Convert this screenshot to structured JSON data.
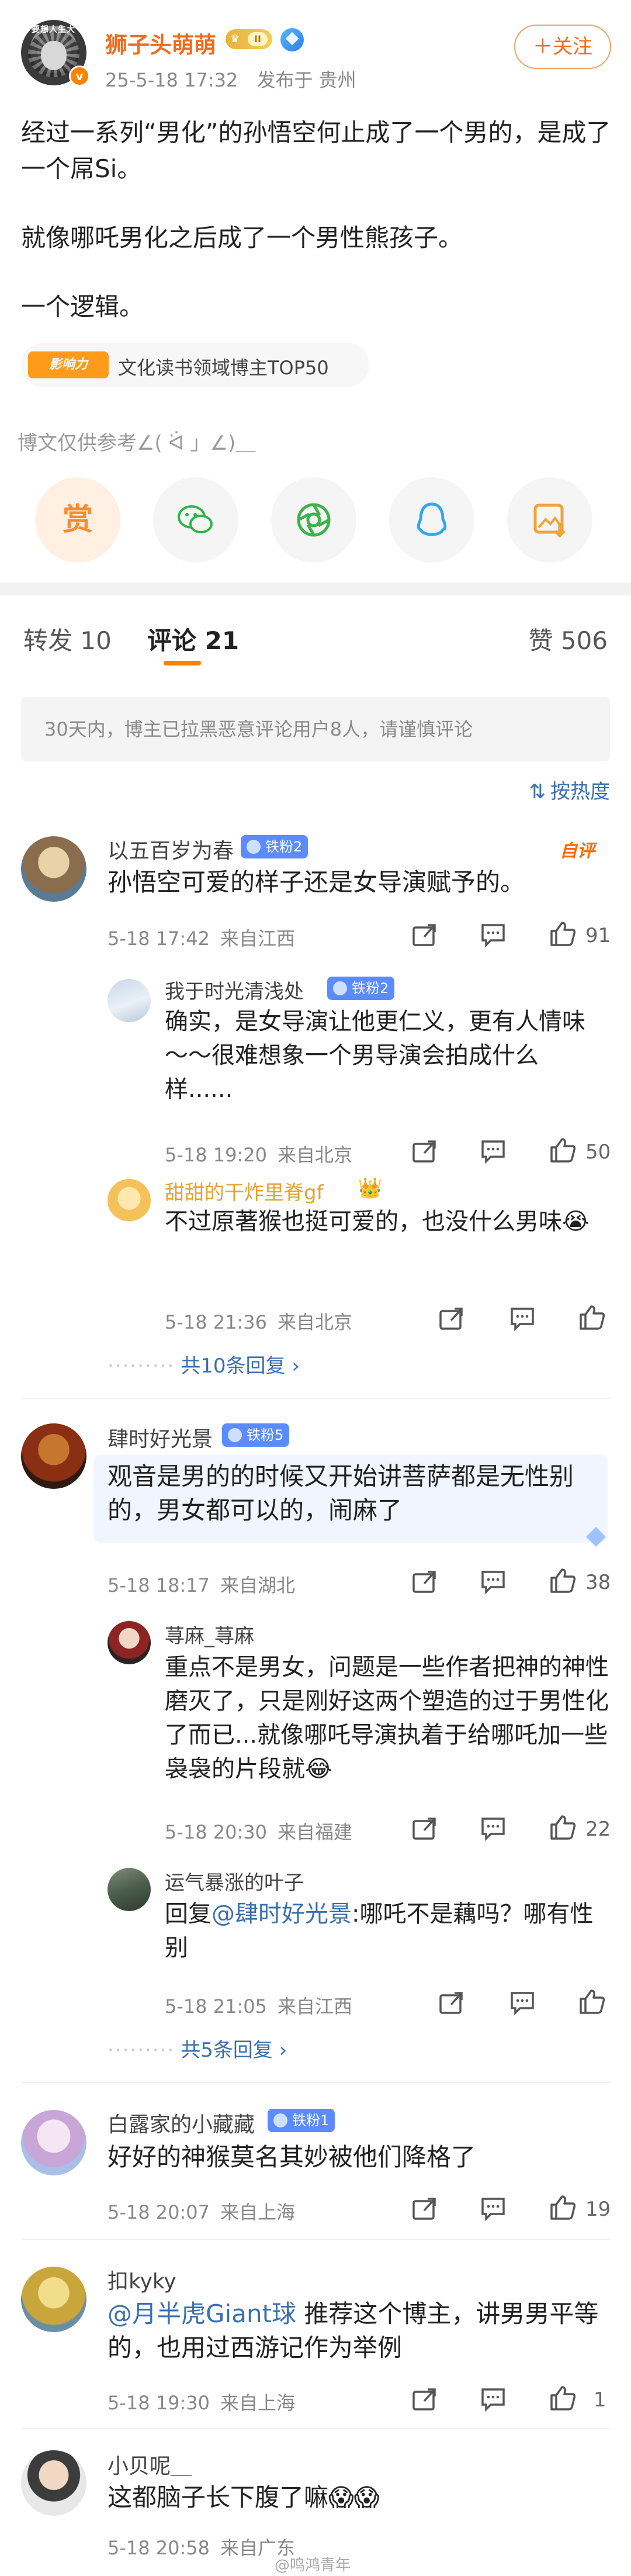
{
  "post": {
    "avatar_caption": "要想人生大",
    "username": "狮子头萌萌",
    "level": "II",
    "date": "25-5-18 17:32",
    "location": "发布于 贵州",
    "follow_label": "＋关注",
    "paragraphs": [
      "经过一系列“男化”的孙悟空何止成了一个男的，是成了一个屌Si。",
      "就像哪吒男化之后成了一个男性熊孩子。",
      "一个逻辑。"
    ],
    "influence_logo": "影响力",
    "influence_text": "文化读书领域博主TOP50",
    "disclaimer": "博文仅供参考∠( ᐛ 」∠)＿",
    "reward_char": "赏"
  },
  "tabs": {
    "repost": "转发 10",
    "comment": "评论 21",
    "like": "赞 506"
  },
  "notice": "30天内，博主已拉黑恶意评论用户8人，请谨慎评论",
  "sort_label": "按热度",
  "comments": [
    {
      "name": "以五百岁为春",
      "badge": "铁粉2",
      "author_fav": "自评",
      "text": "孙悟空可爱的样子还是女导演赋予的。",
      "time": "5-18 17:42",
      "from": "来自江西",
      "likes": "91",
      "replies": [
        {
          "name": "我于时光清浅处",
          "badge": "铁粉2",
          "text": "确实，是女导演让他更仁义，更有人情味～～很难想象一个男导演会拍成什么样......",
          "time": "5-18 19:20",
          "from": "来自北京",
          "likes": "50"
        },
        {
          "name": "甜甜的干炸里脊gf",
          "text": "不过原著猴也挺可爱的，也没什么男味😭",
          "time": "5-18 21:36",
          "from": "来自北京",
          "likes": ""
        }
      ],
      "more": "共10条回复 ›"
    },
    {
      "name": "肆时好光景",
      "badge": "铁粉5",
      "text": "观音是男的的时候又开始讲菩萨都是无性别的，男女都可以的，闹麻了",
      "time": "5-18 18:17",
      "from": "来自湖北",
      "likes": "38",
      "replies": [
        {
          "name": "荨麻_荨麻",
          "text": "重点不是男女，问题是一些作者把神的神性磨灭了，只是刚好这两个塑造的过于男性化了而已...就像哪吒导演执着于给哪吒加一些袅袅的片段就😂",
          "time": "5-18 20:30",
          "from": "来自福建",
          "likes": "22"
        },
        {
          "name": "运气暴涨的叶子",
          "text_prefix": "回复",
          "mention": "@肆时好光景",
          "text": ":哪吒不是藕吗？哪有性别",
          "time": "5-18 21:05",
          "from": "来自江西",
          "likes": ""
        }
      ],
      "more": "共5条回复 ›"
    },
    {
      "name": "白露家的小藏藏",
      "badge": "铁粉1",
      "text": "好好的神猴莫名其妙被他们降格了",
      "time": "5-18 20:07",
      "from": "来自上海",
      "likes": "19"
    },
    {
      "name": "扣kyky",
      "mention": "@月半虎Giant球",
      "text": " 推荐这个博主，讲男男平等的，也用过西游记作为举例",
      "time": "5-18 19:30",
      "from": "来自上海",
      "likes": "1"
    },
    {
      "name": "小贝呢＿",
      "text": "这都脑子长下腹了嘛😱😱",
      "time": "5-18 20:58",
      "from": "来自广东",
      "likes": ""
    }
  ],
  "watermark": "@鸣鸿青年",
  "colors": {
    "accent": "#ff8200",
    "username": "#f36b1c",
    "link": "#3a6fb0",
    "fan_badge": "#5b8cff"
  }
}
